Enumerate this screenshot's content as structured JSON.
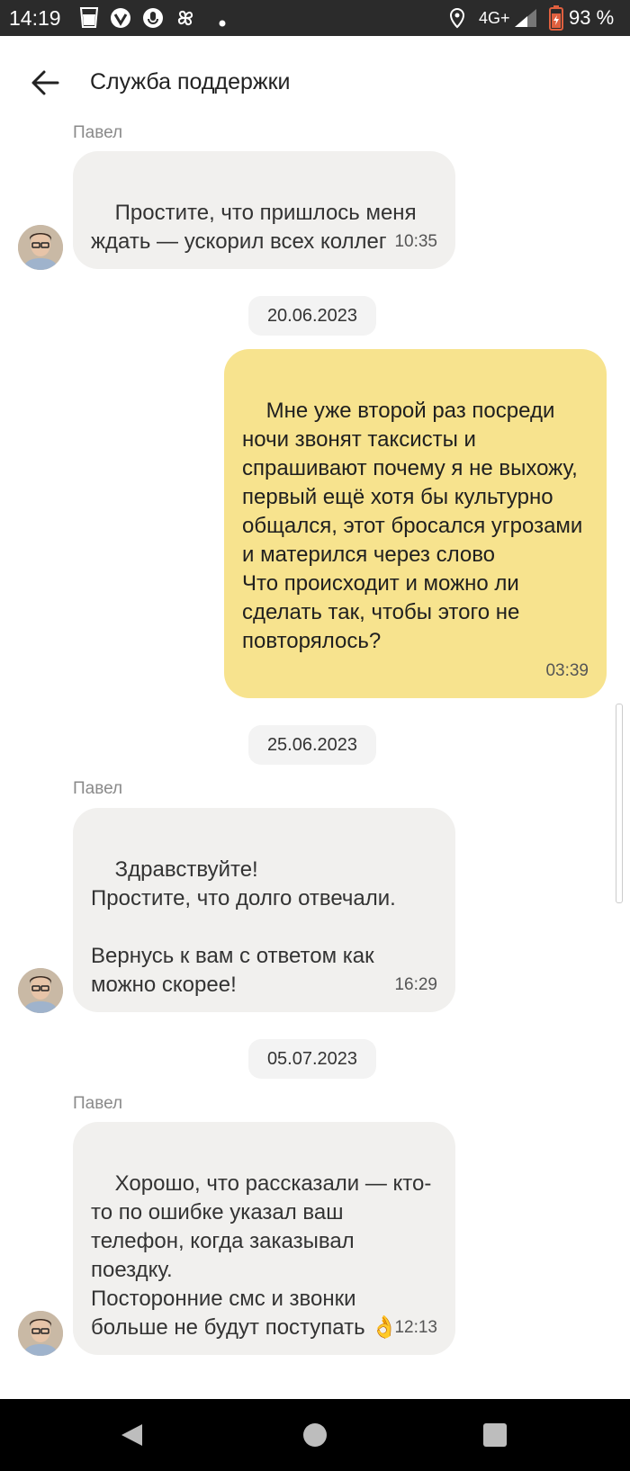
{
  "status_bar": {
    "time": "14:19",
    "network": "4G+",
    "battery": "93 %"
  },
  "header": {
    "title": "Служба поддержки"
  },
  "chat": {
    "messages": [
      {
        "sender": "Павел",
        "text": "Простите, что пришлось меня ждать — ускорил всех коллег",
        "time": "10:35"
      },
      {
        "text": "Мне уже второй раз посреди ночи звонят таксисты и спрашивают почему я не выхожу, первый ещё хотя бы культурно общался, этот бросался угрозами и матерился через слово\nЧто происходит и можно ли сделать так, чтобы этого не повторялось?",
        "time": "03:39"
      },
      {
        "sender": "Павел",
        "text": "Здравствуйте!\nПростите, что долго отвечали.\n\nВернусь к вам с ответом как можно скорее!",
        "time": "16:29"
      },
      {
        "sender": "Павел",
        "text": "Хорошо, что рассказали — кто-то по ошибке указал ваш телефон, когда заказывал поездку.\nПосторонние смс и звонки больше не будут поступать 👌",
        "time": "12:13"
      }
    ],
    "dates": [
      "20.06.2023",
      "25.06.2023",
      "05.07.2023"
    ]
  },
  "colors": {
    "incoming_bubble": "#f1f0ee",
    "outgoing_bubble": "#f7e38e",
    "status_bar": "#2b2b2b",
    "nav_bar": "#000000"
  }
}
